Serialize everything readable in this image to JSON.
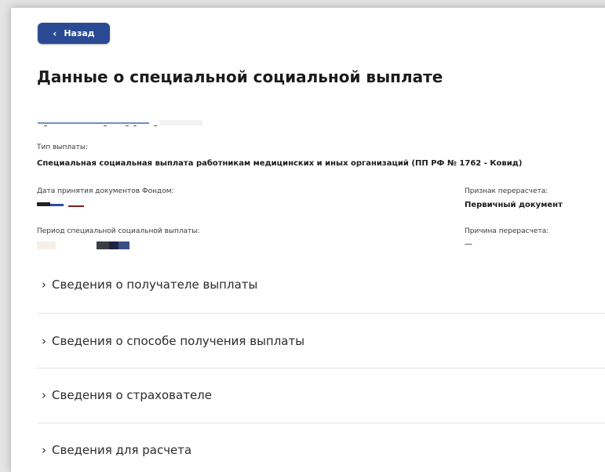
{
  "nav": {
    "back_label": "Назад"
  },
  "page": {
    "title": "Данные о специальной социальной выплате"
  },
  "payment_type": {
    "label": "Тип выплаты:",
    "value": "Специальная социальная выплата работникам медицинских и иных организаций (ПП РФ № 1762 - Ковид)"
  },
  "doc_date": {
    "label": "Дата принятия документов Фондом:"
  },
  "recalc_sign": {
    "label": "Признак перерасчета:",
    "value": "Первичный документ"
  },
  "period": {
    "label": "Период специальной социальной выплаты:"
  },
  "recalc_reason": {
    "label": "Причина перерасчета:",
    "value": "—"
  },
  "sections": [
    {
      "label": "Сведения о получателе выплаты"
    },
    {
      "label": "Сведения о способе получения выплаты"
    },
    {
      "label": "Сведения о страхователе"
    },
    {
      "label": "Сведения для расчета"
    }
  ],
  "colors": {
    "accent": "#2a4a94",
    "background": "#ffffff"
  },
  "icons": {
    "back": "chevron-left-icon",
    "section": "chevron-right-icon"
  }
}
